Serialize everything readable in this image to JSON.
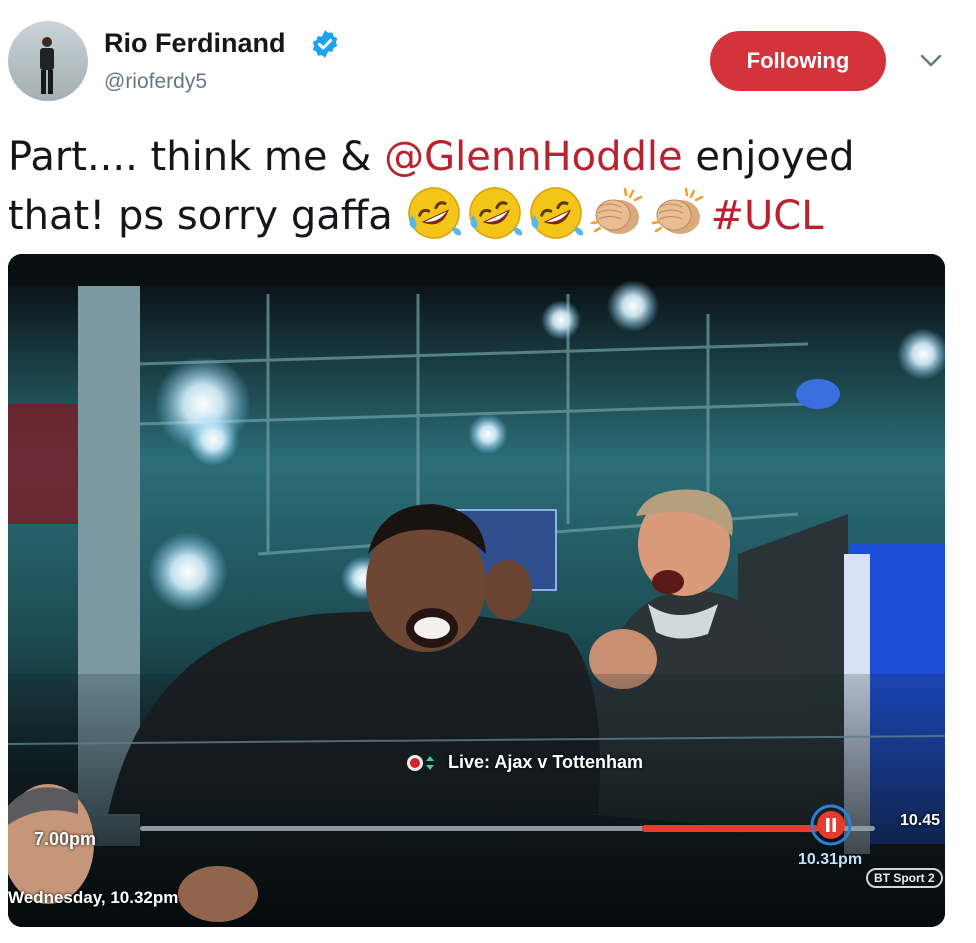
{
  "header": {
    "display_name": "Rio Ferdinand",
    "handle": "@rioferdy5",
    "follow_button_label": "Following"
  },
  "icons": {
    "verified": "verified-badge-icon",
    "caret": "chevron-down-icon",
    "emoji_laugh": "rolling-on-floor-laughing-icon",
    "emoji_clap": "clapping-hands-icon",
    "pause": "pause-icon"
  },
  "colors": {
    "follow_button": "#d3333a",
    "mention": "#b8232f",
    "verified": "#1da1f2",
    "progress": "#e23d2e"
  },
  "tweet": {
    "line1_a": "Part.... think me & ",
    "mention": "@GlennHoddle",
    "line1_b": " enjoyed",
    "line2_a": "that! ps sorry gaffa ",
    "hashtag": "#UCL",
    "laugh_emoji_count": 3,
    "clap_emoji_count": 2
  },
  "media": {
    "live_label": "Live: Ajax v Tottenham",
    "time_start": "7.00pm",
    "time_end": "10.45",
    "time_current": "10.31pm",
    "date_time": "Wednesday, 10.32pm",
    "channel": "BT Sport 2",
    "progress": 0.92
  }
}
